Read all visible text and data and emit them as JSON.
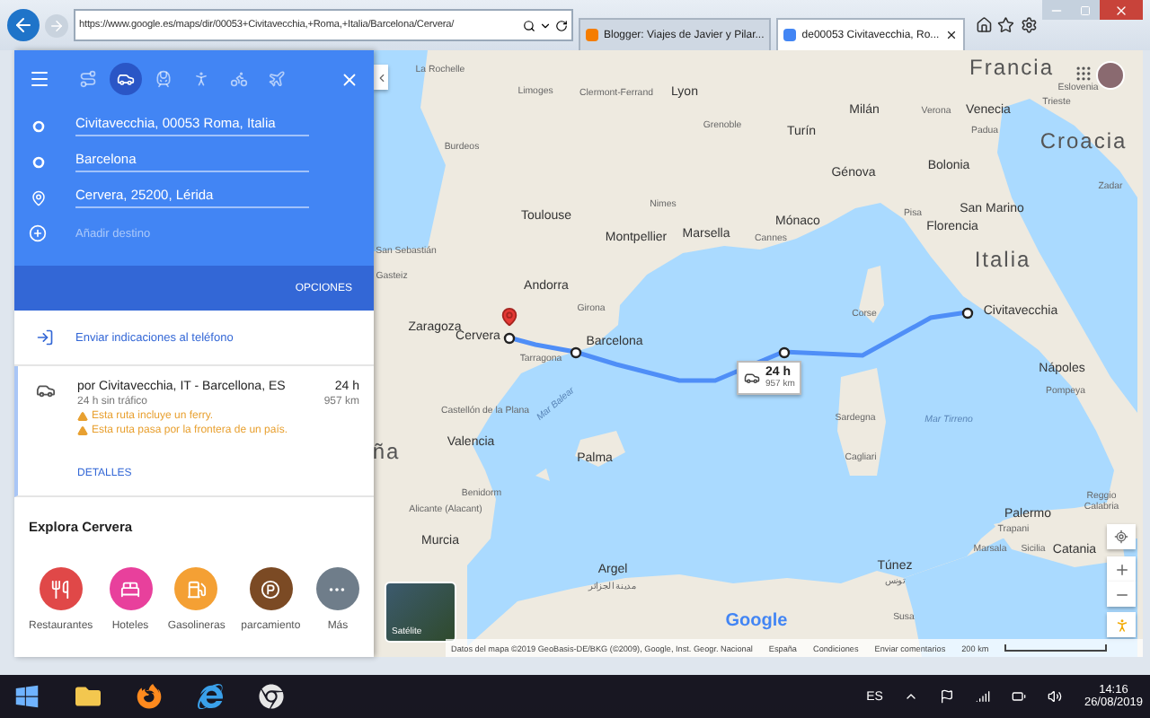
{
  "browser": {
    "address": "https://www.google.es/maps/dir/00053+Civitavecchia,+Roma,+Italia/Barcelona/Cervera/",
    "tabs": [
      {
        "title": "Blogger: Viajes de Javier y Pilar...",
        "selected": false,
        "color": "#f57d00"
      },
      {
        "title": "de00053 Civitavecchia, Ro...",
        "selected": true,
        "color": "#4285f4"
      }
    ]
  },
  "directions": {
    "modes": [
      {
        "kind": "best",
        "selected": false
      },
      {
        "kind": "car",
        "selected": true
      },
      {
        "kind": "train",
        "selected": false
      },
      {
        "kind": "walk",
        "selected": false
      },
      {
        "kind": "bike",
        "selected": false
      },
      {
        "kind": "plane",
        "selected": false
      }
    ],
    "stops": [
      {
        "kind": "origin",
        "text": "Civitavecchia, 00053 Roma, Italia"
      },
      {
        "kind": "waypoint",
        "text": "Barcelona"
      },
      {
        "kind": "destination",
        "text": "Cervera, 25200, Lérida"
      }
    ],
    "add_destination": {
      "placeholder": "Añadir destino"
    },
    "options": "OPCIONES",
    "send": "Enviar indicaciones al teléfono"
  },
  "route": {
    "via": "por Civitavecchia, IT - Barcellona, ES",
    "duration": "24 h",
    "traffic": "24 h sin tráfico",
    "distance": "957 km",
    "warnings": [
      "Esta ruta incluye un ferry.",
      "Esta ruta pasa por la frontera de un país."
    ],
    "details": "DETALLES"
  },
  "explore": {
    "title": "Explora Cervera",
    "categories": [
      {
        "kind": "food",
        "label": "Restaurantes",
        "color": "#e04848"
      },
      {
        "kind": "hotel",
        "label": "Hoteles",
        "color": "#e8409c"
      },
      {
        "kind": "fuel",
        "label": "Gasolineras",
        "color": "#f4a034"
      },
      {
        "kind": "parking",
        "label": "parcamiento",
        "color": "#7b4a24"
      },
      {
        "kind": "more",
        "label": "Más",
        "color": "#6f7d8a"
      }
    ]
  },
  "map": {
    "labels": [
      {
        "kind": "country",
        "text": "Francia"
      },
      {
        "kind": "town",
        "text": "La Rochelle"
      },
      {
        "kind": "town",
        "text": "Limoges"
      },
      {
        "kind": "town",
        "text": "Clermont-Ferrand"
      },
      {
        "kind": "city",
        "text": "Lyon"
      },
      {
        "kind": "town",
        "text": "Grenoble"
      },
      {
        "kind": "town",
        "text": "Burdeos"
      },
      {
        "kind": "city",
        "text": "Milán"
      },
      {
        "kind": "city",
        "text": "Turín"
      },
      {
        "kind": "town",
        "text": "Verona"
      },
      {
        "kind": "city",
        "text": "Venecia"
      },
      {
        "kind": "town",
        "text": "Padua"
      },
      {
        "kind": "town",
        "text": "Trieste"
      },
      {
        "kind": "town",
        "text": "Eslovenia"
      },
      {
        "kind": "country",
        "text": "Croacia"
      },
      {
        "kind": "city",
        "text": "Génova"
      },
      {
        "kind": "city",
        "text": "Bolonia"
      },
      {
        "kind": "town",
        "text": "Zadar"
      },
      {
        "kind": "town",
        "text": "Nimes"
      },
      {
        "kind": "city",
        "text": "Toulouse"
      },
      {
        "kind": "town",
        "text": "Pisa"
      },
      {
        "kind": "city",
        "text": "San Marino"
      },
      {
        "kind": "city",
        "text": "Mónaco"
      },
      {
        "kind": "city",
        "text": "Florencia"
      },
      {
        "kind": "city",
        "text": "Montpellier"
      },
      {
        "kind": "city",
        "text": "Marsella"
      },
      {
        "kind": "town",
        "text": "Cannes"
      },
      {
        "kind": "town",
        "text": "San Sebastián"
      },
      {
        "kind": "country",
        "text": "Italia"
      },
      {
        "kind": "town",
        "text": "Gasteiz"
      },
      {
        "kind": "city",
        "text": "Andorra"
      },
      {
        "kind": "town",
        "text": "Girona"
      },
      {
        "kind": "city",
        "text": "Zaragoza"
      },
      {
        "kind": "city",
        "text": "Cervera"
      },
      {
        "kind": "city",
        "text": "Barcelona"
      },
      {
        "kind": "town",
        "text": "Tarragona"
      },
      {
        "kind": "town",
        "text": "Corse"
      },
      {
        "kind": "city",
        "text": "Civitavecchia"
      },
      {
        "kind": "sea",
        "text": "Mar Tirreno"
      },
      {
        "kind": "city",
        "text": "Nápoles"
      },
      {
        "kind": "town",
        "text": "Pompeya"
      },
      {
        "kind": "town",
        "text": "Castellón de la Plana"
      },
      {
        "kind": "sea",
        "text": "Mar Balear"
      },
      {
        "kind": "town",
        "text": "Sardegna"
      },
      {
        "kind": "city",
        "text": "Valencia"
      },
      {
        "kind": "city",
        "text": "Palma"
      },
      {
        "kind": "town",
        "text": "Cagliari"
      },
      {
        "kind": "town",
        "text": "Benidorm"
      },
      {
        "kind": "town",
        "text": "Alicante (Alacant)"
      },
      {
        "kind": "city",
        "text": "Murcia"
      },
      {
        "kind": "city",
        "text": "Palermo"
      },
      {
        "kind": "town",
        "text": "Reggio Calabria"
      },
      {
        "kind": "town",
        "text": "Trapani"
      },
      {
        "kind": "town",
        "text": "Marsala"
      },
      {
        "kind": "town",
        "text": "Sicilia"
      },
      {
        "kind": "city",
        "text": "Catania"
      },
      {
        "kind": "city",
        "text": "Argel"
      },
      {
        "kind": "town",
        "text": "مدينة الجزائر"
      },
      {
        "kind": "city",
        "text": "Túnez"
      },
      {
        "kind": "town",
        "text": "تونس"
      },
      {
        "kind": "town",
        "text": "Susa"
      },
      {
        "kind": "country",
        "text": "ña"
      }
    ],
    "callout": {
      "duration": "24 h",
      "distance": "957 km"
    },
    "logo": "Google",
    "satellite": "Satélite",
    "attribution": [
      "Datos del mapa ©2019 GeoBasis-DE/BKG (©2009), Google, Inst. Geogr. Nacional",
      "España",
      "Condiciones",
      "Enviar comentarios"
    ],
    "scale": "200 km"
  },
  "taskbar": {
    "language": "ES",
    "time": "14:16",
    "date": "26/08/2019"
  }
}
